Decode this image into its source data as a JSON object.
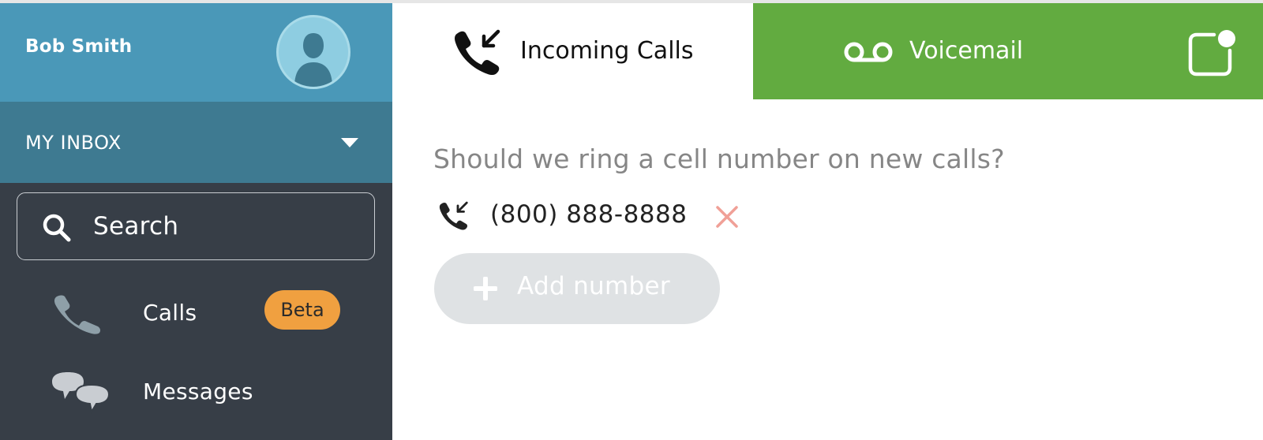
{
  "sidebar": {
    "user_name": "Bob Smith",
    "avatar_icon": "user-avatar-icon",
    "inbox_label": "MY INBOX",
    "search_placeholder": "Search",
    "items": [
      {
        "label": "Calls",
        "icon": "phone-icon",
        "badge": "Beta"
      },
      {
        "label": "Messages",
        "icon": "chat-bubbles-icon"
      }
    ]
  },
  "tabs": [
    {
      "label": "Incoming Calls",
      "icon": "incoming-call-icon",
      "active": true
    },
    {
      "label": "Voicemail",
      "icon": "voicemail-icon",
      "active": false
    },
    {
      "label": "",
      "icon": "notification-icon",
      "active": false
    }
  ],
  "main": {
    "question": "Should we ring a cell number on new calls?",
    "numbers": [
      {
        "value": "(800) 888-8888",
        "icon": "incoming-call-icon",
        "remove_icon": "close-icon"
      }
    ],
    "add_button_label": "Add number"
  },
  "colors": {
    "user_header": "#4a98b8",
    "inbox_bar": "#3e7a91",
    "sidebar": "#373e47",
    "voicemail_tab": "#62ab40",
    "beta_badge": "#f0a040",
    "remove_x": "#f0a097",
    "add_button": "#dfe2e4"
  }
}
